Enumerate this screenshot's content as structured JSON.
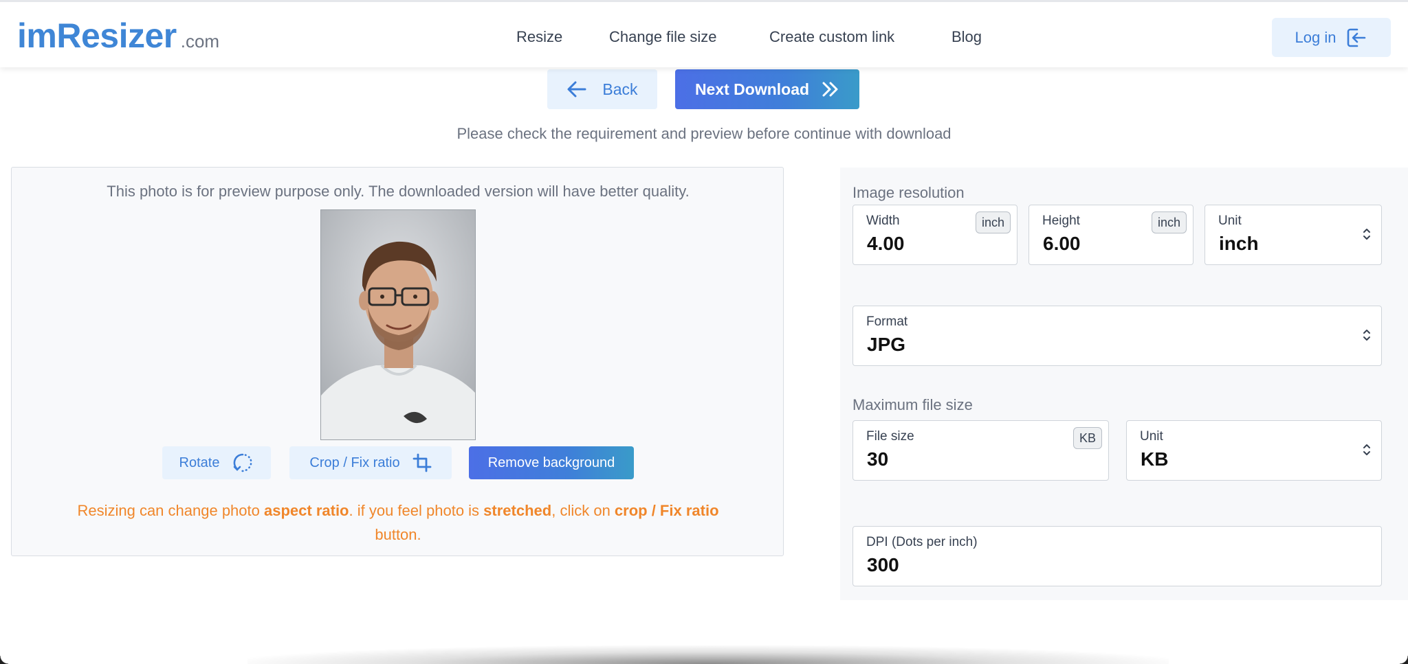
{
  "header": {
    "logo_main": "imResizer",
    "logo_suffix": ".com",
    "nav": [
      "Resize",
      "Change file size",
      "Create custom link",
      "Blog"
    ],
    "login_label": "Log in"
  },
  "actions": {
    "back_label": "Back",
    "next_label": "Next Download",
    "notice": "Please check the requirement and preview before continue with download"
  },
  "preview": {
    "note": "This photo is for preview purpose only. The downloaded version will have better quality.",
    "rotate_label": "Rotate",
    "crop_label": "Crop / Fix ratio",
    "remove_bg_label": "Remove background",
    "warning": {
      "p1": "Resizing can change photo ",
      "b1": "aspect ratio",
      "p2": ". if you feel photo is ",
      "b2": "stretched",
      "p3": ", click on ",
      "b3": "crop / Fix ratio",
      "p4": " button."
    }
  },
  "settings": {
    "resolution_label": "Image resolution",
    "width": {
      "label": "Width",
      "value": "4.00",
      "unit": "inch"
    },
    "height": {
      "label": "Height",
      "value": "6.00",
      "unit": "inch"
    },
    "resolution_unit": {
      "label": "Unit",
      "value": "inch"
    },
    "format": {
      "label": "Format",
      "value": "JPG"
    },
    "max_size_label": "Maximum file size",
    "file_size": {
      "label": "File size",
      "value": "30",
      "unit": "KB"
    },
    "size_unit": {
      "label": "Unit",
      "value": "KB"
    },
    "dpi": {
      "label": "DPI (Dots per inch)",
      "value": "300"
    }
  },
  "colors": {
    "accent": "#3b7dd8",
    "button_light_bg": "#e8f2fd",
    "warning": "#f0862a"
  },
  "icons": {
    "back": "arrow-left-icon",
    "next": "double-chevron-right-icon",
    "login": "login-icon",
    "rotate": "rotate-icon",
    "crop": "crop-icon",
    "select": "select-updown-icon"
  }
}
